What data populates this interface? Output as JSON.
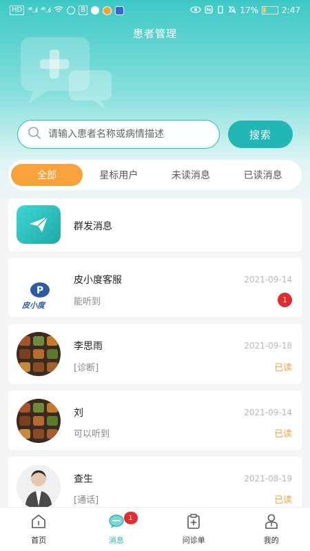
{
  "status_bar": {
    "chips": [
      "HD",
      "B"
    ],
    "signal_1": "⁴⁶..ıl",
    "signal_2": "⁴⁶..ıl",
    "battery": "17%",
    "time": "2:47"
  },
  "header": {
    "title": "患者管理"
  },
  "search": {
    "placeholder": "请输入患者名称或病情描述",
    "value": "",
    "button_label": "搜索"
  },
  "tabs": [
    {
      "label": "全部",
      "active": true
    },
    {
      "label": "星标用户",
      "active": false
    },
    {
      "label": "未读消息",
      "active": false
    },
    {
      "label": "已读消息",
      "active": false
    }
  ],
  "mass_message": {
    "label": "群发消息",
    "icon": "paper-plane-icon"
  },
  "conversations": [
    {
      "name": "皮小度客服",
      "date": "2021-09-14",
      "message": "能听到",
      "unread_count": "1",
      "logo_text": "皮小度"
    },
    {
      "name": "李思雨",
      "date": "2021-09-18",
      "message": "[诊断]",
      "status": "已读"
    },
    {
      "name": "刘",
      "date": "2021-09-14",
      "message": "可以听到",
      "status": "已读"
    },
    {
      "name": "查生",
      "date": "2021-08-19",
      "message": "[通话]",
      "status": "已读"
    }
  ],
  "bottom_nav": [
    {
      "label": "首页",
      "icon": "home-icon"
    },
    {
      "label": "消息",
      "icon": "chat-icon",
      "badge": "1",
      "active": true
    },
    {
      "label": "问诊单",
      "icon": "clipboard-icon"
    },
    {
      "label": "我的",
      "icon": "doctor-icon"
    }
  ],
  "colors": {
    "primary": "#22b7b4",
    "accent": "#f7a23a",
    "badge": "#e52a2a"
  }
}
